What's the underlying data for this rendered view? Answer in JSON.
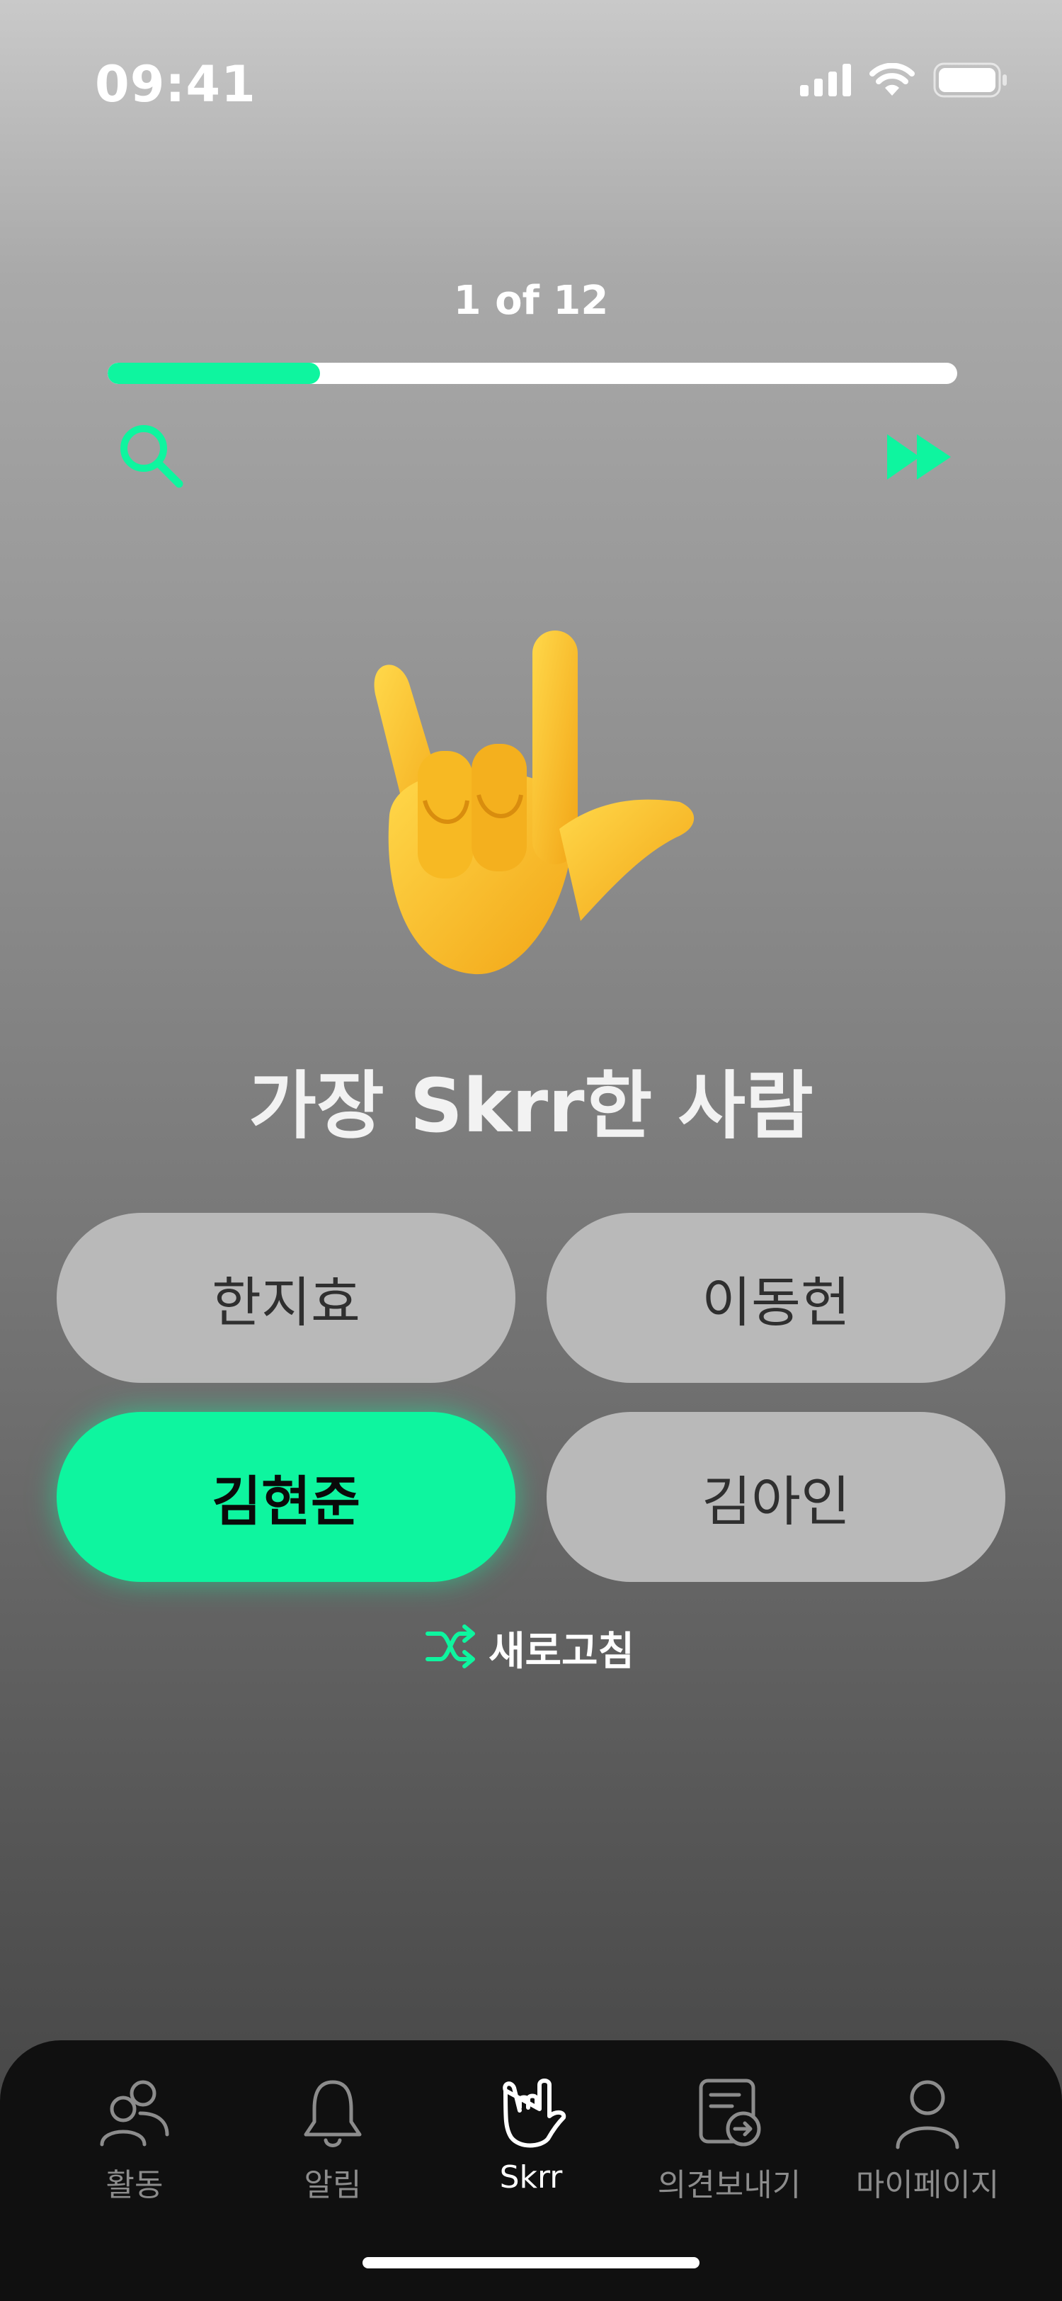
{
  "status_bar": {
    "time": "09:41",
    "icons": [
      "cellular-signal-icon",
      "wifi-icon",
      "battery-icon"
    ]
  },
  "progress": {
    "label": "1 of 12",
    "current": 1,
    "total": 12,
    "fill_fraction": 0.25
  },
  "toolbar": {
    "search_icon": "search-icon",
    "skip_icon": "fast-forward-icon"
  },
  "question": {
    "emoji": "love-you-gesture-hand",
    "text": "가장 Skrr한 사람"
  },
  "options": [
    {
      "label": "한지효",
      "selected": false
    },
    {
      "label": "이동헌",
      "selected": false
    },
    {
      "label": "김현준",
      "selected": true
    },
    {
      "label": "김아인",
      "selected": false
    }
  ],
  "refresh": {
    "icon": "shuffle-icon",
    "label": "새로고침"
  },
  "tab_bar": {
    "tabs": [
      {
        "label": "활동",
        "icon": "people-icon",
        "active": false
      },
      {
        "label": "알림",
        "icon": "bell-icon",
        "active": false
      },
      {
        "label": "Skrr",
        "icon": "rock-hand-icon",
        "active": true
      },
      {
        "label": "의견보내기",
        "icon": "feedback-document-icon",
        "active": false
      },
      {
        "label": "마이페이지",
        "icon": "person-icon",
        "active": false
      }
    ]
  },
  "colors": {
    "accent": "#0ef59f",
    "option_bg": "#b9b9b9",
    "tab_bar_bg": "#101010",
    "tab_inactive": "#8c8c8c"
  }
}
